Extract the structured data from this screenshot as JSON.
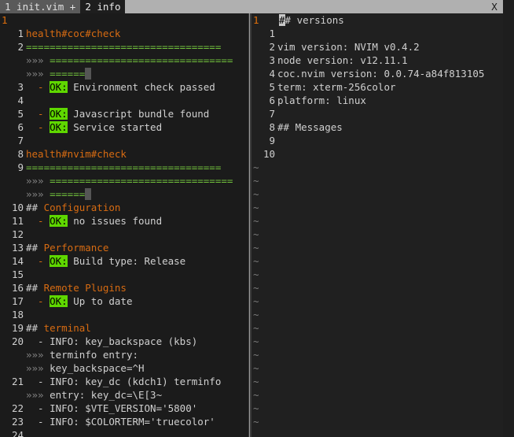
{
  "tabs": [
    {
      "label": "1 init.vim +"
    },
    {
      "label": "2 info"
    }
  ],
  "close_label": "X",
  "left": {
    "top_ln": "1",
    "lines": [
      {
        "ln": "1",
        "text": "health#coc#check",
        "kind": "heading"
      },
      {
        "ln": "2",
        "text": "=================================",
        "kind": "eq"
      },
      {
        "ln": "",
        "text": "»»» ===============================",
        "kind": "eqwrap"
      },
      {
        "ln": "",
        "text": "»»» ======",
        "kind": "eqwrap_end"
      },
      {
        "ln": "3",
        "ok": "OK:",
        "text": " Environment check passed",
        "kind": "ok"
      },
      {
        "ln": "4",
        "text": "",
        "kind": "blank"
      },
      {
        "ln": "5",
        "ok": "OK:",
        "text": " Javascript bundle found",
        "kind": "ok"
      },
      {
        "ln": "6",
        "ok": "OK:",
        "text": " Service started",
        "kind": "ok"
      },
      {
        "ln": "7",
        "text": "",
        "kind": "blank"
      },
      {
        "ln": "8",
        "text": "health#nvim#check",
        "kind": "heading"
      },
      {
        "ln": "9",
        "text": "=================================",
        "kind": "eq"
      },
      {
        "ln": "",
        "text": "»»» ===============================",
        "kind": "eqwrap"
      },
      {
        "ln": "",
        "text": "»»» ======",
        "kind": "eqwrap_end"
      },
      {
        "ln": "10",
        "prefix": "## ",
        "text": "Configuration",
        "kind": "section"
      },
      {
        "ln": "11",
        "ok": "OK:",
        "text": " no issues found",
        "kind": "ok"
      },
      {
        "ln": "12",
        "text": "",
        "kind": "blank"
      },
      {
        "ln": "13",
        "prefix": "## ",
        "text": "Performance",
        "kind": "section"
      },
      {
        "ln": "14",
        "ok": "OK:",
        "text": " Build type: Release",
        "kind": "ok"
      },
      {
        "ln": "15",
        "text": "",
        "kind": "blank"
      },
      {
        "ln": "16",
        "prefix": "## ",
        "text": "Remote Plugins",
        "kind": "section"
      },
      {
        "ln": "17",
        "ok": "OK:",
        "text": " Up to date",
        "kind": "ok"
      },
      {
        "ln": "18",
        "text": "",
        "kind": "blank"
      },
      {
        "ln": "19",
        "prefix": "## ",
        "text": "terminal",
        "kind": "section"
      },
      {
        "ln": "20",
        "text": "  - INFO: key_backspace (kbs)",
        "kind": "info"
      },
      {
        "ln": "",
        "text": "»»» terminfo entry:",
        "kind": "wrap"
      },
      {
        "ln": "",
        "text": "»»» key_backspace=^H",
        "kind": "wrap"
      },
      {
        "ln": "21",
        "text": "  - INFO: key_dc (kdch1) terminfo",
        "kind": "info"
      },
      {
        "ln": "",
        "text": "»»» entry: key_dc=\\E[3~",
        "kind": "wrap"
      },
      {
        "ln": "22",
        "text": "  - INFO: $VTE_VERSION='5800'",
        "kind": "info"
      },
      {
        "ln": "23",
        "text": "  - INFO: $COLORTERM='truecolor'",
        "kind": "info"
      },
      {
        "ln": "24",
        "text": "",
        "kind": "blank"
      }
    ]
  },
  "right": {
    "top_ln": "1",
    "lines": [
      {
        "ln": "",
        "text": "## versions",
        "kind": "cursorline"
      },
      {
        "ln": "1",
        "text": "",
        "kind": "blank"
      },
      {
        "ln": "2",
        "text": "vim version: NVIM v0.4.2"
      },
      {
        "ln": "3",
        "text": "node version: v12.11.1"
      },
      {
        "ln": "4",
        "text": "coc.nvim version: 0.0.74-a84f813105"
      },
      {
        "ln": "5",
        "text": "term: xterm-256color"
      },
      {
        "ln": "6",
        "text": "platform: linux"
      },
      {
        "ln": "7",
        "text": ""
      },
      {
        "ln": "8",
        "text": "## Messages"
      },
      {
        "ln": "9",
        "text": ""
      },
      {
        "ln": "10",
        "text": ""
      }
    ],
    "tilde": "~",
    "tilde_count": 20
  }
}
